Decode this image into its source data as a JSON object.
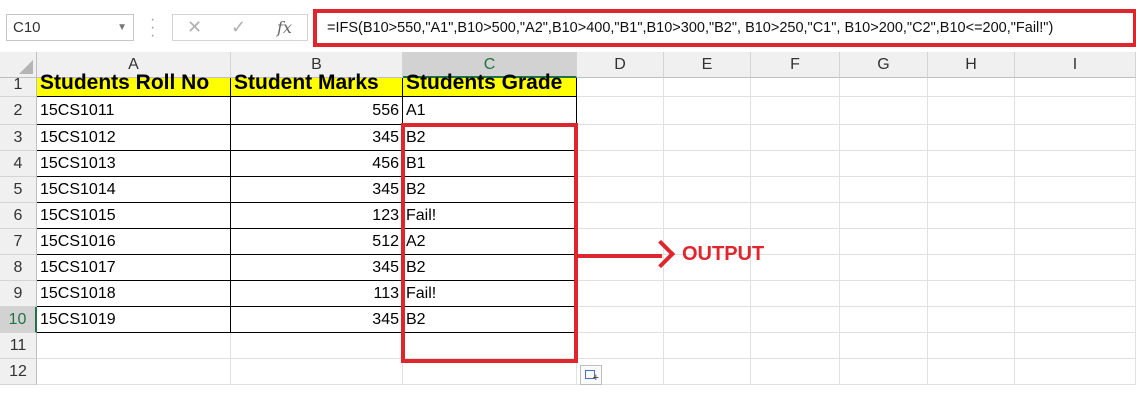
{
  "formula_bar": {
    "name_box": "C10",
    "cancel_icon": "✕",
    "enter_icon": "✓",
    "fx_label": "fx",
    "formula": "=IFS(B10>550,\"A1\",B10>500,\"A2\",B10>400,\"B1\",B10>300,\"B2\", B10>250,\"C1\", B10>200,\"C2\",B10<=200,\"Fail!\")"
  },
  "columns": [
    "A",
    "B",
    "C",
    "D",
    "E",
    "F",
    "G",
    "H",
    "I"
  ],
  "selected_column": "C",
  "rows": [
    "1",
    "2",
    "3",
    "4",
    "5",
    "6",
    "7",
    "8",
    "9",
    "10",
    "11",
    "12"
  ],
  "selected_row": "10",
  "headers": {
    "a": "Students Roll No",
    "b": "Student Marks",
    "c": "Students Grade"
  },
  "data": [
    {
      "roll": "15CS1011",
      "marks": "556",
      "grade": "A1"
    },
    {
      "roll": "15CS1012",
      "marks": "345",
      "grade": "B2"
    },
    {
      "roll": "15CS1013",
      "marks": "456",
      "grade": "B1"
    },
    {
      "roll": "15CS1014",
      "marks": "345",
      "grade": "B2"
    },
    {
      "roll": "15CS1015",
      "marks": "123",
      "grade": "Fail!"
    },
    {
      "roll": "15CS1016",
      "marks": "512",
      "grade": "A2"
    },
    {
      "roll": "15CS1017",
      "marks": "345",
      "grade": "B2"
    },
    {
      "roll": "15CS1018",
      "marks": "113",
      "grade": "Fail!"
    },
    {
      "roll": "15CS1019",
      "marks": "345",
      "grade": "B2"
    }
  ],
  "annotation": {
    "label": "OUTPUT",
    "color": "#e0262d"
  },
  "icons": {
    "quick_analysis": "quick-analysis-icon"
  }
}
